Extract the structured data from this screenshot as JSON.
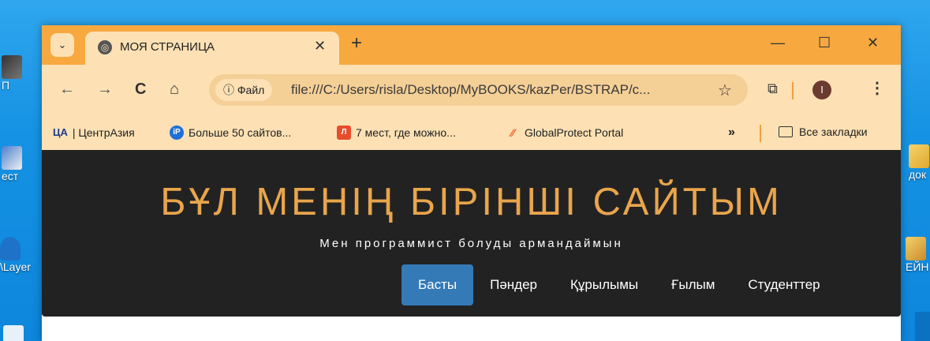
{
  "desktop": {
    "icons": [
      {
        "label": "П"
      },
      {
        "label": "ест"
      },
      {
        "label": "\\Layer"
      },
      {
        "label": "док"
      },
      {
        "label": "ЕЙН"
      }
    ]
  },
  "browser": {
    "tab": {
      "title": "МОЯ СТРАНИЦА",
      "close": "✕"
    },
    "new_tab": "+",
    "window_controls": {
      "minimize": "—",
      "maximize": "☐",
      "close": "✕"
    },
    "nav": {
      "back": "←",
      "forward": "→",
      "reload": "C",
      "home": "⌂"
    },
    "address": {
      "chip_label": "ⓘ Файл",
      "url": "file:///C:/Users/risla/Desktop/MyBOOKS/kazPer/BSTRAP/c..."
    },
    "profile_initial": "I",
    "bookmarks": [
      {
        "label": "| ЦентрАзия",
        "icon_text": "ЦА",
        "color": "#1b3c8f"
      },
      {
        "label": "Больше 50 сайтов...",
        "icon_text": "iP",
        "color": "#1e6fd9"
      },
      {
        "label": "7 мест, где можно...",
        "icon_text": "Л",
        "color": "#e74c2c"
      },
      {
        "label": "GlobalProtect Portal",
        "icon_text": "",
        "color": "#f25a28"
      }
    ],
    "bookmarks_overflow": "»",
    "all_bookmarks": "Все закладки"
  },
  "site": {
    "title": "БҰЛ МЕНІҢ БІРІНШІ САЙТЫМ",
    "subtitle": "Мен программист болуды армандаймын",
    "nav": [
      {
        "label": "Басты",
        "active": true
      },
      {
        "label": "Пәндер",
        "active": false
      },
      {
        "label": "Құрылымы",
        "active": false
      },
      {
        "label": "Ғылым",
        "active": false
      },
      {
        "label": "Студенттер",
        "active": false
      }
    ],
    "colors": {
      "hero_bg": "#222222",
      "title": "#e9a54c",
      "active_nav": "#337ab7"
    }
  }
}
